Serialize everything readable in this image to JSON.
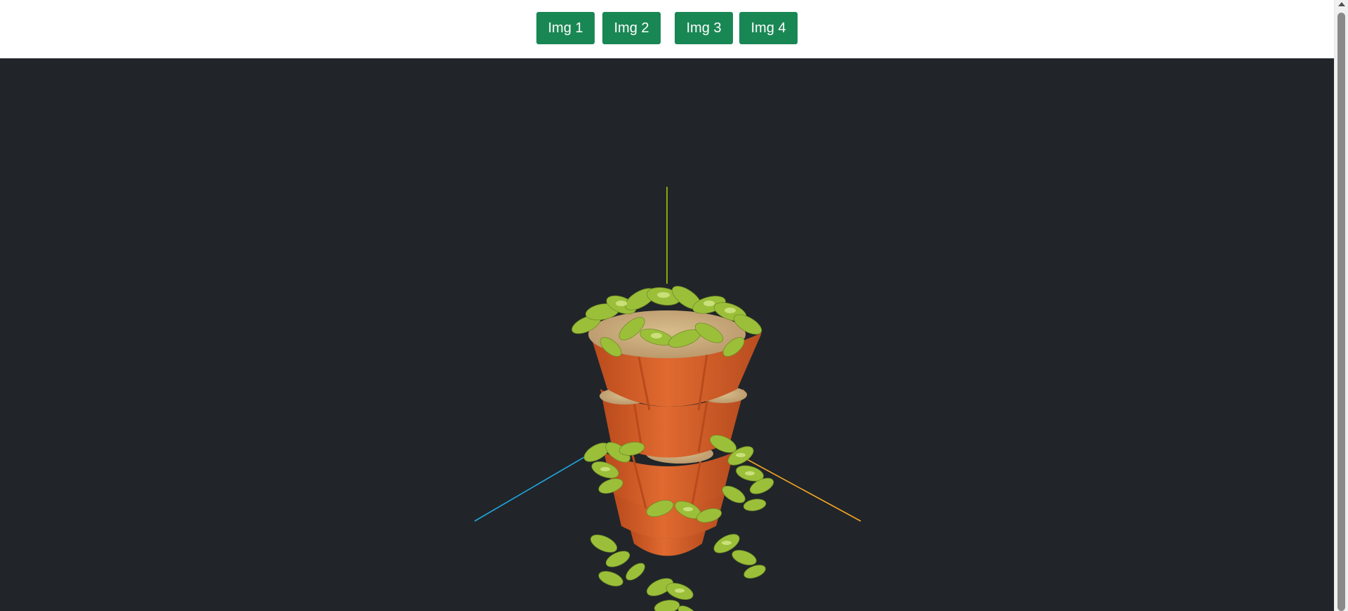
{
  "toolbar": {
    "buttons": [
      {
        "label": "Img 1"
      },
      {
        "label": "Img 2"
      },
      {
        "label": "Img 3"
      },
      {
        "label": "Img 4"
      }
    ]
  },
  "viewport": {
    "background": "#212529",
    "model": "stacked-planter-tower-icon",
    "axes": {
      "x_color": "#f5a623",
      "y_color": "#9ccc00",
      "z_color": "#1fa7e0"
    },
    "colors": {
      "pot": "#d9622b",
      "pot_dark": "#b94a1c",
      "soil": "#c9a877",
      "leaf": "#9cbf3a",
      "leaf_light": "#c9e07a"
    }
  },
  "colors": {
    "button": "#198754",
    "button_text": "#ffffff"
  }
}
